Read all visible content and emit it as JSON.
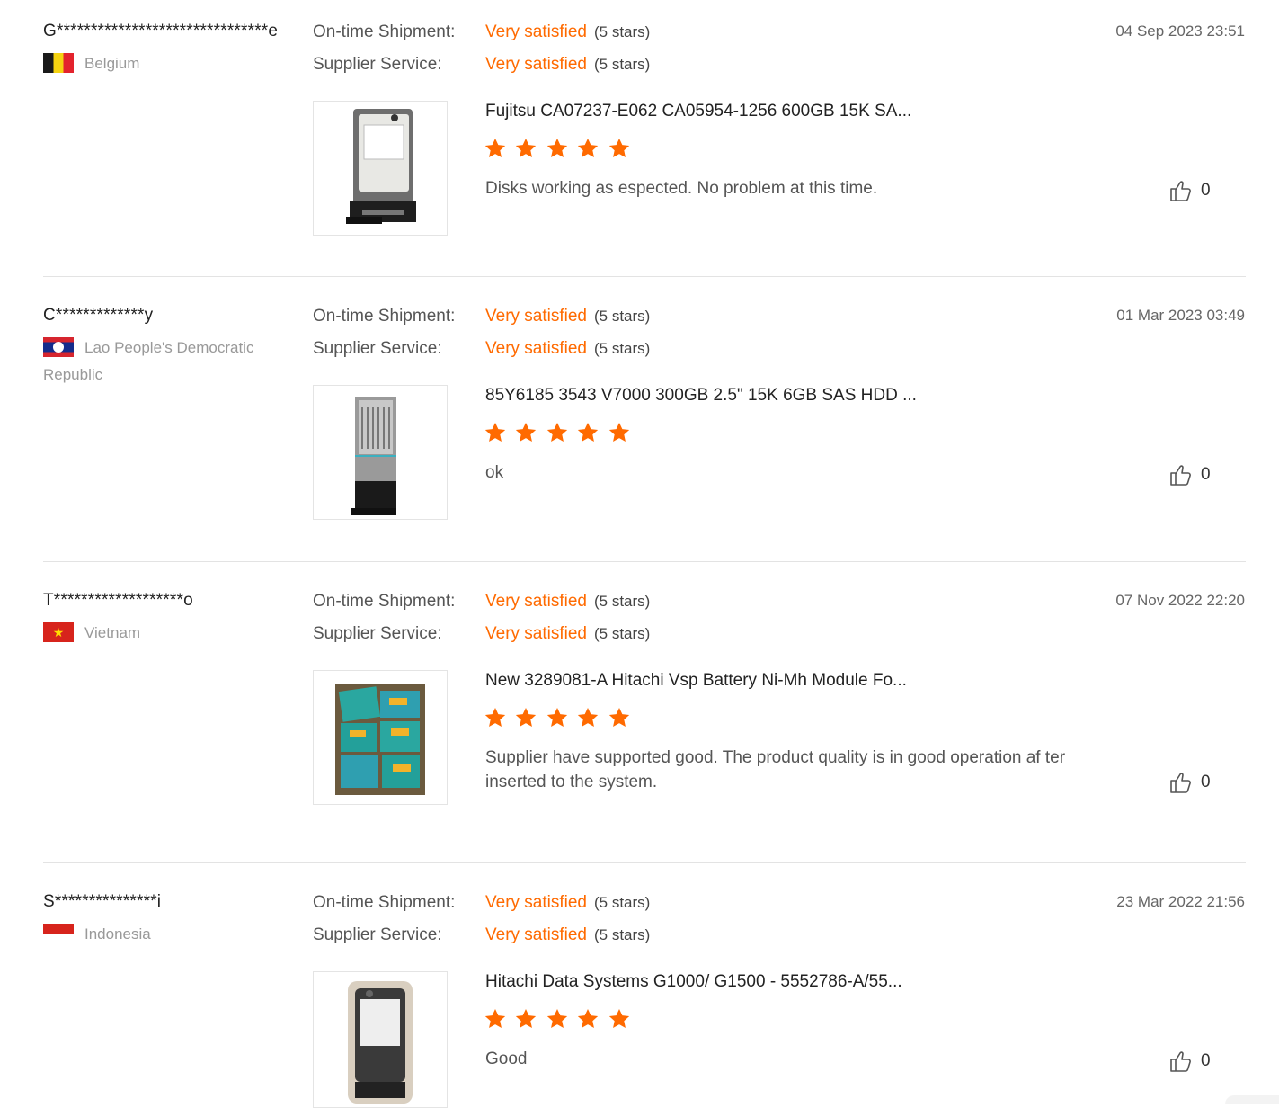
{
  "reviews": [
    {
      "buyer": "G*******************************e",
      "country": "Belgium",
      "flag": "belgium-flag",
      "ontime_label": "On-time Shipment:",
      "ontime_value": "Very satisfied",
      "ontime_stars": "(5 stars)",
      "service_label": "Supplier Service:",
      "service_value": "Very satisfied",
      "service_stars": "(5 stars)",
      "date": "04 Sep 2023 23:51",
      "product": "Fujitsu CA07237-E062 CA05954-1256 600GB 15K SA...",
      "rating": 5,
      "text": "Disks working as espected. No problem at this time.",
      "likes": "0"
    },
    {
      "buyer": "C*************y",
      "country": "Lao People's Democratic Republic",
      "flag": "laos-flag",
      "ontime_label": "On-time Shipment:",
      "ontime_value": "Very satisfied",
      "ontime_stars": "(5 stars)",
      "service_label": "Supplier Service:",
      "service_value": "Very satisfied",
      "service_stars": "(5 stars)",
      "date": "01 Mar 2023 03:49",
      "product": "85Y6185 3543 V7000 300GB 2.5\" 15K 6GB SAS HDD ...",
      "rating": 5,
      "text": "ok",
      "likes": "0"
    },
    {
      "buyer": "T*******************o",
      "country": "Vietnam",
      "flag": "vietnam-flag",
      "ontime_label": "On-time Shipment:",
      "ontime_value": "Very satisfied",
      "ontime_stars": "(5 stars)",
      "service_label": "Supplier Service:",
      "service_value": "Very satisfied",
      "service_stars": "(5 stars)",
      "date": "07 Nov 2022 22:20",
      "product": "New 3289081-A Hitachi Vsp Battery Ni-Mh Module Fo...",
      "rating": 5,
      "text": "Supplier have supported good. The product quality is in good operation af ter inserted to the system.",
      "likes": "0"
    },
    {
      "buyer": "S***************i",
      "country": "Indonesia",
      "flag": "indonesia-flag",
      "ontime_label": "On-time Shipment:",
      "ontime_value": "Very satisfied",
      "ontime_stars": "(5 stars)",
      "service_label": "Supplier Service:",
      "service_value": "Very satisfied",
      "service_stars": "(5 stars)",
      "date": "23 Mar 2022 21:56",
      "product": "Hitachi Data Systems G1000/ G1500 - 5552786-A/55...",
      "rating": 5,
      "text": "Good",
      "likes": "0"
    }
  ],
  "icons": {
    "star": "star-icon",
    "like": "thumbs-up-icon"
  },
  "colors": {
    "accent": "#ff6a00",
    "star": "#ff6a00",
    "divider": "#e3e3e3"
  }
}
